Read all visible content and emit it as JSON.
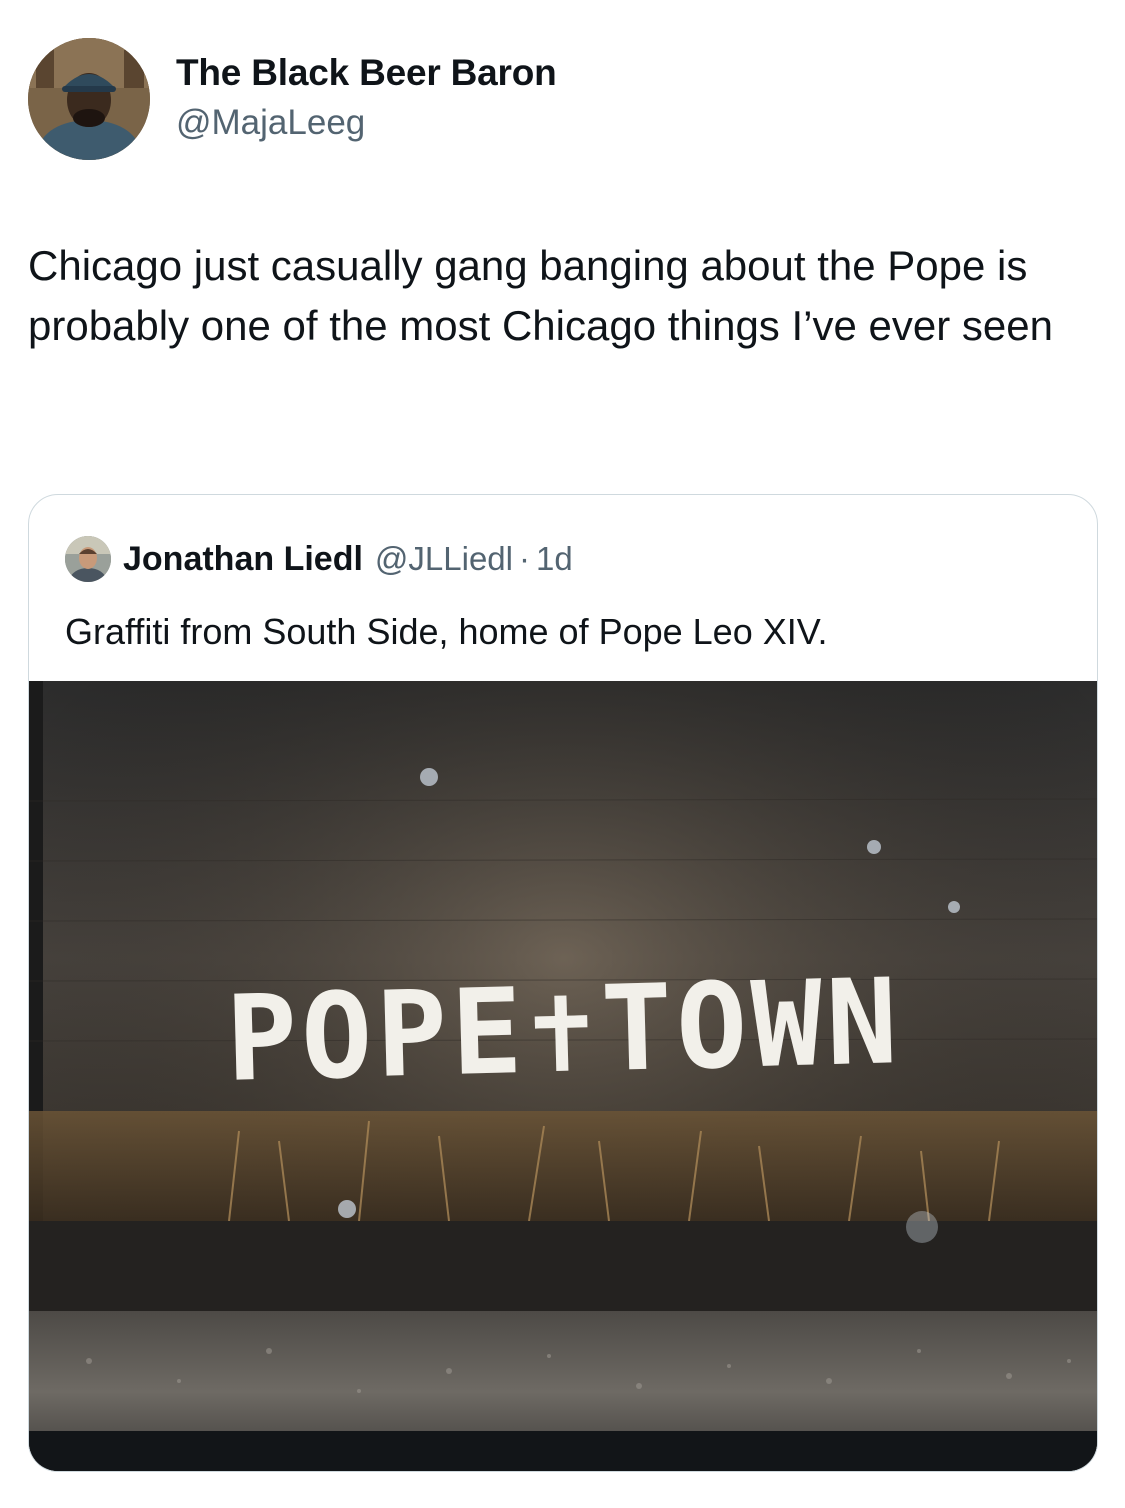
{
  "author": {
    "display_name": "The Black Beer Baron",
    "handle": "@MajaLeeg",
    "avatar": "user-avatar-photo"
  },
  "tweet": {
    "text": "Chicago just casually gang banging about the Pope is probably one of the most Chicago things I’ve ever seen"
  },
  "quoted_tweet": {
    "display_name": "Jonathan Liedl",
    "handle": "@JLLiedl",
    "separator": "·",
    "timestamp": "1d",
    "text": "Graffiti from South Side, home of Pope Leo XIV.",
    "avatar": "user-avatar-photo",
    "image": {
      "graffiti_text": "POPE✝TOWN",
      "description_icon": "photo-graffiti"
    }
  },
  "colors": {
    "text_primary": "#0f1419",
    "text_secondary": "#536471",
    "card_border": "#cfd9de"
  }
}
